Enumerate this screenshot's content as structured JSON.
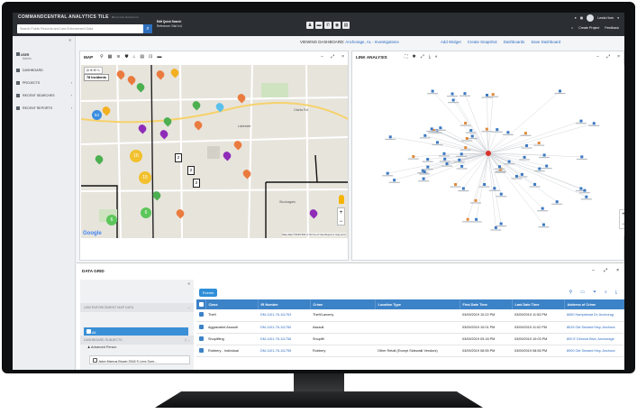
{
  "app": {
    "brand": "COMMANDCENTRAL ANALYTICS TILE",
    "brand_sub": "Motorola Solutions",
    "search_placeholder": "Search Public Records and Law Enforcement Data",
    "edit_search_title": "Edit Quick Search",
    "edit_search_sub": "Reference: Dist 1n1",
    "user_name": "Lewis Hore",
    "create_project": "Create Project",
    "feedback": "Feedback"
  },
  "sidebar": {
    "user_label": "USER",
    "user_sub": "Admin",
    "items": [
      {
        "label": "DASHBOARD",
        "chevron": ""
      },
      {
        "label": "PROJECTS",
        "chevron": "›"
      },
      {
        "label": "RECENT SEARCHES",
        "chevron": "›"
      },
      {
        "label": "RECENT REPORTS",
        "chevron": "›"
      }
    ]
  },
  "dashboard": {
    "viewing_label": "VIEWING DASHBOARD:",
    "viewing_name": "Anchorage, AL - Investigations",
    "actions": [
      "Add Widget",
      "Create Snapshot",
      "Dashboards",
      "Save Dashboard"
    ]
  },
  "map": {
    "title": "MAP",
    "incidents": "78 Incidents",
    "google": "Google",
    "footer": "Map data ©2019   500 m   Terms of Use   Report a map error",
    "labels": [
      {
        "t": "Lakeside"
      },
      {
        "t": "Clarks Rd"
      },
      {
        "t": "Stuckagain"
      }
    ],
    "clusters": [
      {
        "n": "16",
        "c": "#f2c12e"
      },
      {
        "n": "15",
        "c": "#f2c12e"
      },
      {
        "n": "6",
        "c": "#5cc65a"
      },
      {
        "n": "6",
        "c": "#5cc65a"
      },
      {
        "n": "54",
        "c": "#3b8ee0"
      }
    ],
    "flags": [
      "2",
      "2",
      "2"
    ]
  },
  "link": {
    "title": "LINK ANALYSIS"
  },
  "grid": {
    "title": "DATA GRID",
    "tab": "Events",
    "left_section": "LAW ENFORCEMENT MAP DATA",
    "all_label": "All",
    "subjects_section": "DASHBOARD SUBJECTS",
    "advanced_person": "Advanced Person",
    "person": "Jalon Marcus Brown 2518 S Lexx Sum...",
    "columns": [
      "Class",
      "IR Number",
      "Crime",
      "Location Type",
      "First Date Time",
      "Last Date Time",
      "Address of Crime"
    ],
    "rows": [
      [
        "Theft",
        "DM-1101-76-111763",
        "Theft/Larceny",
        "",
        "03/09/2019 10:22 PM",
        "03/09/2019 11:53 PM",
        "6650 Hampstead Dr, Anchorag"
      ],
      [
        "Aggravated Assault",
        "DM-1101-76-111760",
        "Assault",
        "",
        "03/09/2019 10:01 PM",
        "03/09/2019 11:02 PM",
        "8615 Old Seward Hwy, Anchora"
      ],
      [
        "Shoplifting",
        "DM-1101-76-111756",
        "Shoplift",
        "",
        "03/09/2019 09:18 PM",
        "03/09/2019 10:03 PM",
        "800 E Dimond Blvd, Anchorage"
      ],
      [
        "Robbery - Individual",
        "DM-1101-76-111755",
        "Robbery",
        "Other Retail (Except Sidewalk Vendors)",
        "03/09/2019 08:55 PM",
        "03/09/2019 08:55 PM",
        "8900 Old Seward Hwy, Anchora"
      ]
    ]
  }
}
